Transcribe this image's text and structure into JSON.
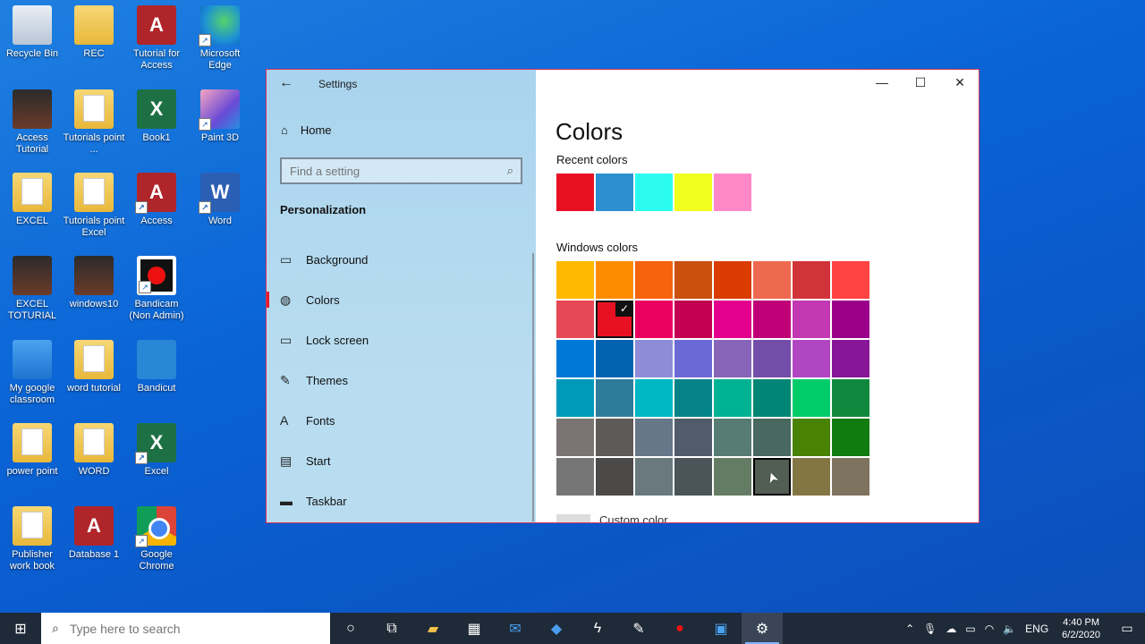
{
  "desktop": {
    "icons": [
      {
        "label": "Recycle Bin"
      },
      {
        "label": "REC"
      },
      {
        "label": "Tutorial for Access"
      },
      {
        "label": "Microsoft Edge"
      },
      {
        "label": "Access Tutorial"
      },
      {
        "label": "Tutorials point ..."
      },
      {
        "label": "Book1"
      },
      {
        "label": "Paint 3D"
      },
      {
        "label": "EXCEL"
      },
      {
        "label": "Tutorials point Excel"
      },
      {
        "label": "Access"
      },
      {
        "label": "Word"
      },
      {
        "label": "EXCEL TOTURIAL"
      },
      {
        "label": "windows10"
      },
      {
        "label": "Bandicam (Non Admin)"
      },
      {
        "label": "My google classroom"
      },
      {
        "label": "word tutorial"
      },
      {
        "label": "Bandicut"
      },
      {
        "label": "power point"
      },
      {
        "label": "WORD"
      },
      {
        "label": "Excel"
      },
      {
        "label": "Publisher work book"
      },
      {
        "label": "Database 1"
      },
      {
        "label": "Google Chrome"
      }
    ]
  },
  "settings": {
    "title": "Settings",
    "home": "Home",
    "search_placeholder": "Find a setting",
    "section": "Personalization",
    "nav": [
      {
        "label": "Background",
        "icon": "image-icon"
      },
      {
        "label": "Colors",
        "icon": "palette-icon",
        "active": true
      },
      {
        "label": "Lock screen",
        "icon": "lock-screen-icon"
      },
      {
        "label": "Themes",
        "icon": "themes-icon"
      },
      {
        "label": "Fonts",
        "icon": "fonts-icon"
      },
      {
        "label": "Start",
        "icon": "start-icon"
      },
      {
        "label": "Taskbar",
        "icon": "taskbar-icon"
      }
    ],
    "page_title": "Colors",
    "recent_label": "Recent colors",
    "recent_colors": [
      "#e81123",
      "#2d8fd0",
      "#2cfcf0",
      "#f0ff1e",
      "#ff88c8"
    ],
    "windows_label": "Windows colors",
    "windows_colors": [
      "#ffb900",
      "#ff8c00",
      "#f7630c",
      "#ca5010",
      "#da3b01",
      "#ef6950",
      "#d13438",
      "#ff4343",
      "#e74856",
      "#e81123",
      "#ea005e",
      "#c30052",
      "#e3008c",
      "#bf0077",
      "#c239b3",
      "#9a0089",
      "#0078d7",
      "#0063b1",
      "#8e8cd8",
      "#6b69d6",
      "#8764b8",
      "#744da9",
      "#b146c2",
      "#881798",
      "#0099bc",
      "#2d7d9a",
      "#00b7c3",
      "#038387",
      "#00b294",
      "#018574",
      "#00cc6a",
      "#10893e",
      "#7a7574",
      "#5d5a58",
      "#68768a",
      "#515c6b",
      "#567c73",
      "#486860",
      "#498205",
      "#107c10",
      "#767676",
      "#4c4a48",
      "#69797e",
      "#4a5459",
      "#647c64",
      "#525e54",
      "#847545",
      "#7e735f"
    ],
    "selected_index": 9,
    "hover_index": 45,
    "custom_label": "Custom color"
  },
  "taskbar": {
    "search_placeholder": "Type here to search",
    "lang": "ENG",
    "time": "4:40 PM",
    "date": "6/2/2020"
  }
}
